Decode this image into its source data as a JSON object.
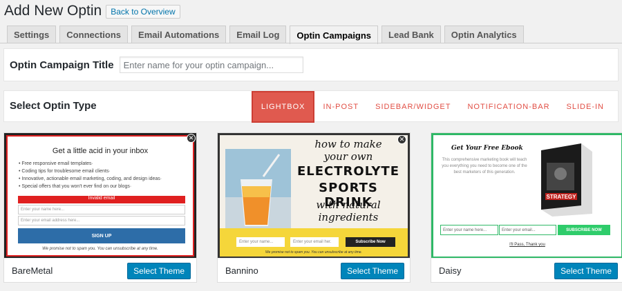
{
  "header": {
    "title": "Add New Optin",
    "back_label": "Back to Overview"
  },
  "tabs": [
    {
      "label": "Settings"
    },
    {
      "label": "Connections"
    },
    {
      "label": "Email Automations"
    },
    {
      "label": "Email Log"
    },
    {
      "label": "Optin Campaigns",
      "active": true
    },
    {
      "label": "Lead Bank"
    },
    {
      "label": "Optin Analytics"
    }
  ],
  "campaign_title": {
    "label": "Optin Campaign Title",
    "placeholder": "Enter name for your optin campaign..."
  },
  "optin_type": {
    "label": "Select Optin Type",
    "options": [
      "LIGHTBOX",
      "IN-POST",
      "SIDEBAR/WIDGET",
      "NOTIFICATION-BAR",
      "SLIDE-IN"
    ],
    "selected": "LIGHTBOX"
  },
  "themes": [
    {
      "name": "BareMetal",
      "button": "Select Theme",
      "preview": {
        "heading": "Get a little acid in your inbox",
        "bullets": [
          "Free responsive email templates·",
          "Coding tips for troublesome email clients·",
          "Innovative, actionable email marketing, coding, and design ideas·",
          "Special offers that you won't ever find on our blogs·"
        ],
        "error": "Invalid email",
        "name_placeholder": "Enter your name here...",
        "email_placeholder": "Enter your email address here...",
        "submit": "SIGN UP",
        "note": "We promise not to spam you. You can unsubscribe at any time."
      }
    },
    {
      "name": "Bannino",
      "button": "Select Theme",
      "preview": {
        "line1": "how to make",
        "line2": "your own",
        "line3": "ELECTROLYTE",
        "line4": "SPORTS DRINK",
        "line5": "with natural",
        "line6": "ingredients",
        "name_placeholder": "Enter your name...",
        "email_placeholder": "Enter your email her.",
        "submit": "Subscribe Now",
        "note": "We promise not to spam you. You can unsubscribe at any time."
      }
    },
    {
      "name": "Daisy",
      "button": "Select Theme",
      "preview": {
        "heading": "Get Your Free Ebook",
        "text": "This comprehensive marketing book will teach you everything you need to become one of the best marketers of this generation.",
        "book_title": "STRATEGY",
        "name_placeholder": "Enter your name here...",
        "email_placeholder": "Enter your email...",
        "submit": "SUBSCRIBE NOW",
        "decline": "I'll Pass, Thank you"
      }
    }
  ],
  "colors": {
    "accent": "#e05a4f",
    "button_blue": "#0085ba",
    "daisy_green": "#2fb866",
    "bannino_yellow": "#f5d63a"
  }
}
